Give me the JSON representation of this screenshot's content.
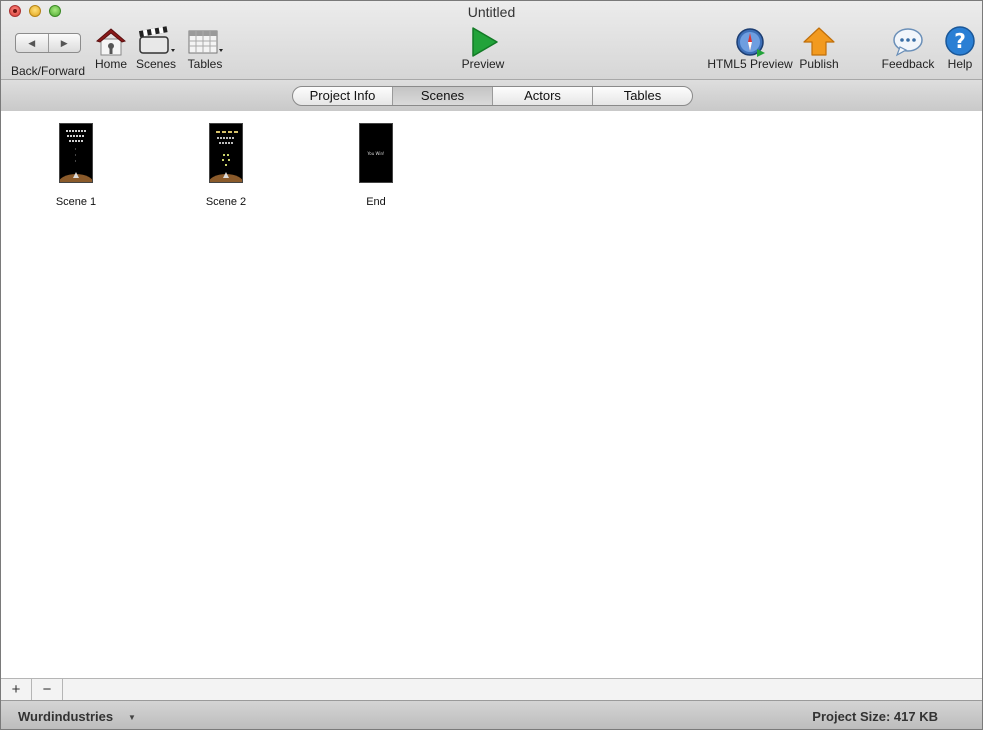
{
  "window": {
    "title": "Untitled"
  },
  "toolbar": {
    "back_forward": "Back/Forward",
    "home": "Home",
    "scenes": "Scenes",
    "tables": "Tables",
    "preview": "Preview",
    "html5_preview": "HTML5 Preview",
    "publish": "Publish",
    "feedback": "Feedback",
    "help": "Help"
  },
  "tabs": [
    {
      "label": "Project Info",
      "active": false
    },
    {
      "label": "Scenes",
      "active": true
    },
    {
      "label": "Actors",
      "active": false
    },
    {
      "label": "Tables",
      "active": false
    }
  ],
  "scenes": [
    {
      "name": "Scene 1"
    },
    {
      "name": "Scene 2"
    },
    {
      "name": "End",
      "thumb_text": "You Win!"
    }
  ],
  "bottom": {
    "add": "+",
    "remove": "−",
    "team": "Wurdindustries",
    "project_size": "Project Size: 417 KB"
  },
  "colors": {
    "preview_green": "#22a33a",
    "publish_orange": "#f29a1f",
    "help_blue": "#2a7fd4"
  }
}
